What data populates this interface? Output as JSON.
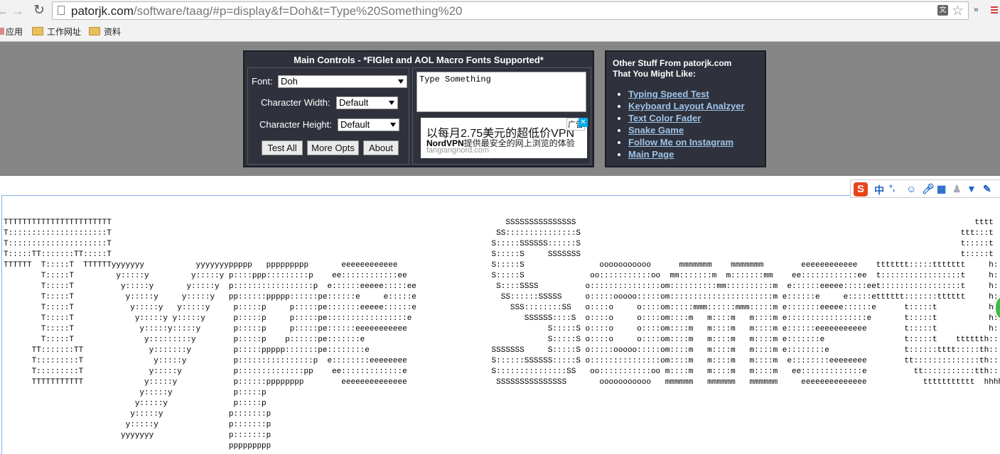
{
  "browser": {
    "url_host": "patorjk.com",
    "url_path": "/software/taag/#p=display&f=Doh&t=Type%20Something%20",
    "bookmarks": [
      "应用",
      "工作网址",
      "资料"
    ],
    "extensions_more": "»",
    "translate_icon_text": "文"
  },
  "main_controls": {
    "title": "Main Controls - *FIGlet and AOL Macro Fonts Supported*",
    "font_label": "Font:",
    "font_value": "Doh",
    "char_width_label": "Character Width:",
    "char_width_value": "Default",
    "char_height_label": "Character Height:",
    "char_height_value": "Default",
    "buttons": {
      "test_all": "Test All",
      "more_opts": "More Opts",
      "about": "About"
    },
    "text_input": "Type Something"
  },
  "ad": {
    "headline": "以每月2.75美元的超低价VPN",
    "brand": "NordVPN",
    "sub": "提供最安全的网上浏览的体验",
    "domain": "fangiangnord.com",
    "badge": "广告",
    "close": "✕"
  },
  "other_stuff": {
    "title_line1": "Other Stuff From patorjk.com",
    "title_line2": "That You Might Like:",
    "links": [
      "Typing Speed Test",
      "Keyboard Layout Analzyer",
      "Text Color Fader",
      "Snake Game",
      "Follow Me on Instagram",
      "Main Page"
    ]
  },
  "ime": {
    "logo": "S",
    "mode": "中",
    "punct": "°,",
    "icons": [
      "emoji-icon",
      "mic-icon",
      "keyboard-icon",
      "user-icon",
      "shirt-icon",
      "wrench-icon"
    ]
  },
  "output_ascii": "TTTTTTTTTTTTTTTTTTTTTTT                                                                                    SSSSSSSSSSSSSSS                                                                                     tttt          hhhhhhh\nT:::::::::::::::::::::T                                                                                  SS:::::::::::::::S                                                                                 ttt:::t          h:::::h\nT:::::::::::::::::::::T                                                                                 S:::::SSSSSS::::::S                                                                                 t:::::t          h:::::h\nT:::::TT:::::::TT:::::T                                                                                 S:::::S     SSSSSSS                                                                                 t:::::t          h:::::h\nTTTTTT  T:::::T  TTTTTTyyyyyyy           yyyyyyyppppp   ppppppppp       eeeeeeeeeeee                    S:::::S                ooooooooooo      mmmmmmm    mmmmmmm        eeeeeeeeeeee    ttttttt:::::ttttttt     h::::h hhhhh\n        T:::::T         y:::::y         y:::::y p::::ppp:::::::::p    ee::::::::::::ee                  S:::::S              oo:::::::::::oo  mm:::::::m  m:::::::mm    ee::::::::::::ee  t:::::::::::::::::t     h::::hh:::::hhh\n        T:::::T          y:::::y       y:::::y  p:::::::::::::::::p  e::::::eeeee:::::ee                 S::::SSSS          o:::::::::::::::om::::::::::mm::::::::::m  e::::::eeeee:::::eet:::::::::::::::::t     h::::::::::::::hh\n        T:::::T           y:::::y     y:::::y   pp::::::ppppp::::::pe::::::e     e:::::e                  SS::::::SSSSS     o:::::ooooo:::::om::::::::::::::::::::::m e::::::e     e:::::etttttt:::::::tttttt     h:::::::hhh::::::h\n        T:::::T            y:::::y   y:::::y     p:::::p     p:::::pe:::::::eeeee::::::e                    SSS::::::::SS   o::::o     o::::om:::::mmm::::::mmm:::::m e:::::::eeeee::::::e      t:::::t           h::::::h   h::::::h\n        T:::::T             y:::::y y:::::y      p:::::p     p:::::pe:::::::::::::::::e                        SSSSSS::::S  o::::o     o::::om::::m   m::::m   m::::m e:::::::::::::::::e       t:::::t           h:::::h     h:::::h\n        T:::::T              y:::::y:::::y       p:::::p     p:::::pe::::::eeeeeeeeeee                              S:::::S o::::o     o::::om::::m   m::::m   m::::m e::::::eeeeeeeeeee        t:::::t           h:::::h     h:::::h\n        T:::::T               y:::::::::y        p:::::p    p::::::pe:::::::e                                       S:::::S o::::o     o::::om::::m   m::::m   m::::m e:::::::e                 t:::::t    tttttth:::::h     h:::::h\n      TT:::::::TT              y:::::::y         p:::::ppppp:::::::pe::::::::e                          SSSSSSS     S:::::S o:::::ooooo:::::om::::m   m::::m   m::::m e::::::::e                t::::::tttt:::::th:::::h     h:::::h\n      T:::::::::T               y:::::y          p::::::::::::::::p  e::::::::eeeeeeee                  S::::::SSSSSS:::::S o:::::::::::::::om::::m   m::::m   m::::m  e::::::::eeeeeeee        tt::::::::::::::th:::::h     h:::::h\n      T:::::::::T              y:::::y           p::::::::::::::pp    ee:::::::::::::e                  S:::::::::::::::SS   oo:::::::::::oo m::::m   m::::m   m::::m   ee:::::::::::::e          tt:::::::::::tth:::::h     h:::::h\n      TTTTTTTTTTT             y:::::y            p::::::pppppppp        eeeeeeeeeeeeee                   SSSSSSSSSSSSSSS       ooooooooooo   mmmmmm   mmmmmm   mmmmmm     eeeeeeeeeeeeee            ttttttttttt  hhhhhhh     hhhhhhh\n                             y:::::y             p:::::p\n                            y:::::y              p:::::p\n                           y:::::y              p:::::::p\n                          y:::::y               p:::::::p\n                         yyyyyyy                p:::::::p\n                                                ppppppppp"
}
